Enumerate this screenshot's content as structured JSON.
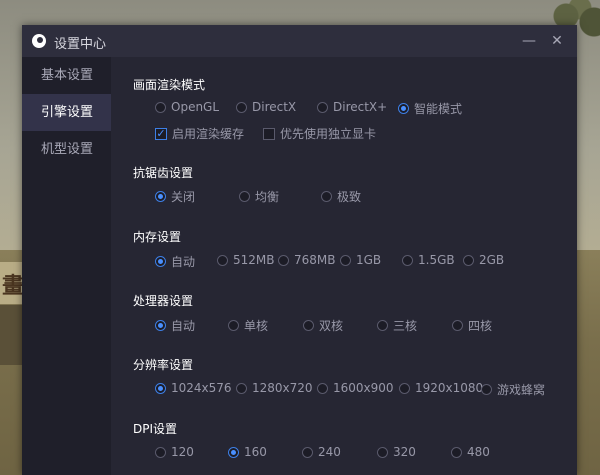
{
  "background": {
    "top_text_left": "",
    "top_text_mid": "",
    "sign_text": "畫"
  },
  "window": {
    "title": "设置中心",
    "minimize_label": "—",
    "close_label": "✕"
  },
  "sidebar": {
    "items": [
      {
        "label": "基本设置",
        "active": false
      },
      {
        "label": "引擎设置",
        "active": true
      },
      {
        "label": "机型设置",
        "active": false
      }
    ]
  },
  "render_mode": {
    "title": "画面渲染模式",
    "options": [
      "OpenGL",
      "DirectX",
      "DirectX+",
      "智能模式"
    ],
    "selected": "智能模式",
    "enable_cache_label": "启用渲染缓存",
    "enable_cache_checked": true,
    "prefer_gpu_label": "优先使用独立显卡",
    "prefer_gpu_checked": false
  },
  "antialias": {
    "title": "抗锯齿设置",
    "options": [
      "关闭",
      "均衡",
      "极致"
    ],
    "selected": "关闭"
  },
  "memory": {
    "title": "内存设置",
    "options": [
      "自动",
      "512MB",
      "768MB",
      "1GB",
      "1.5GB",
      "2GB"
    ],
    "selected": "自动"
  },
  "cpu": {
    "title": "处理器设置",
    "options": [
      "自动",
      "单核",
      "双核",
      "三核",
      "四核"
    ],
    "selected": "自动"
  },
  "resolution": {
    "title": "分辨率设置",
    "options": [
      "1024x576",
      "1280x720",
      "1600x900",
      "1920x1080",
      "游戏蜂窝"
    ],
    "selected": "1024x576"
  },
  "dpi": {
    "title": "DPI设置",
    "options": [
      "120",
      "160",
      "240",
      "320",
      "480"
    ],
    "selected": "160"
  },
  "colors": {
    "accent": "#4a90ff",
    "dialog_bg": "#262633",
    "sidebar_bg": "#1f1f2a",
    "sidebar_active_bg": "#33334a"
  }
}
